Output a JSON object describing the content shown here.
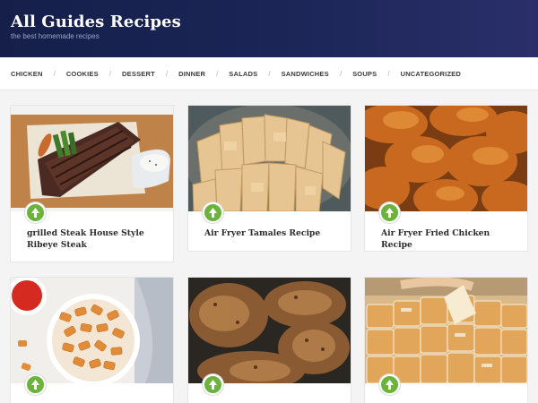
{
  "site": {
    "title": "All Guides Recipes",
    "tagline": "the best homemade recipes"
  },
  "nav": {
    "items": [
      "CHICKEN",
      "COOKIES",
      "DESSERT",
      "DINNER",
      "SALADS",
      "SANDWICHES",
      "SOUPS",
      "UNCATEGORIZED"
    ],
    "separator": "/"
  },
  "posts": [
    {
      "title": "grilled Steak House Style Ribeye Steak",
      "image": "steak-photo"
    },
    {
      "title": "Air Fryer Tamales Recipe",
      "image": "tamales-photo"
    },
    {
      "title": "Air Fryer Fried Chicken Recipe",
      "image": "fried-chicken-photo"
    },
    {
      "title": "",
      "image": "pasta-bowl-photo"
    },
    {
      "title": "",
      "image": "pork-chops-photo"
    },
    {
      "title": "",
      "image": "pull-apart-bread-photo"
    }
  ],
  "colors": {
    "header_start": "#151f4a",
    "header_end": "#2a2f6a",
    "badge_green": "#6cb33e"
  }
}
